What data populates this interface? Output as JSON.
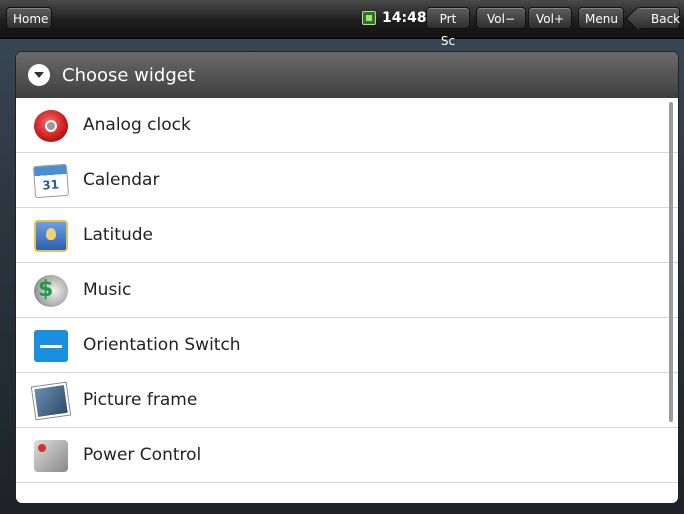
{
  "topbar": {
    "home_label": "Home",
    "time": "14:48",
    "prtsc_label": "Prt Sc",
    "voldown_label": "Vol−",
    "volup_label": "Vol+",
    "menu_label": "Menu",
    "back_label": "Back"
  },
  "dialog": {
    "title": "Choose widget",
    "items": [
      {
        "label": "Analog clock",
        "icon": "analog-clock-icon"
      },
      {
        "label": "Calendar",
        "icon": "calendar-icon"
      },
      {
        "label": "Latitude",
        "icon": "latitude-icon"
      },
      {
        "label": "Music",
        "icon": "music-icon"
      },
      {
        "label": "Orientation Switch",
        "icon": "orientation-switch-icon"
      },
      {
        "label": "Picture frame",
        "icon": "picture-frame-icon"
      },
      {
        "label": "Power Control",
        "icon": "power-control-icon"
      }
    ]
  }
}
